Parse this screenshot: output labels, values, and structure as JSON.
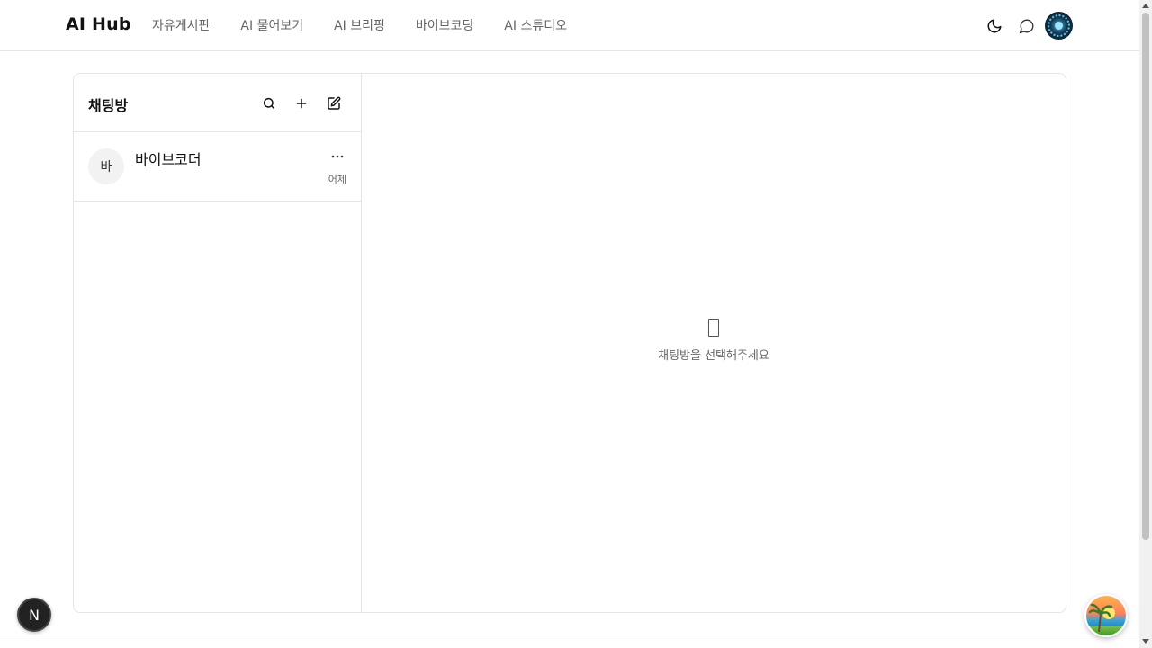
{
  "header": {
    "brand": "AI Hub",
    "nav": [
      {
        "label": "자유게시판"
      },
      {
        "label": "AI 물어보기"
      },
      {
        "label": "AI 브리핑"
      },
      {
        "label": "바이브코딩"
      },
      {
        "label": "AI 스튜디오"
      }
    ],
    "icons": [
      "moon-icon",
      "chat-bubble-icon",
      "user-avatar"
    ]
  },
  "sidebar": {
    "title": "채팅방",
    "tools": [
      "search-icon",
      "plus-icon",
      "edit-icon"
    ],
    "rooms": [
      {
        "avatar": "바",
        "name": "바이브코더",
        "time": "어제",
        "more": "···"
      }
    ]
  },
  "chat": {
    "empty_message": "채팅방을 선택해주세요"
  },
  "floating": {
    "next_badge": "N"
  },
  "colors": {
    "border": "#e5e5e5",
    "muted_text": "#666666",
    "brand_text": "#111111"
  }
}
